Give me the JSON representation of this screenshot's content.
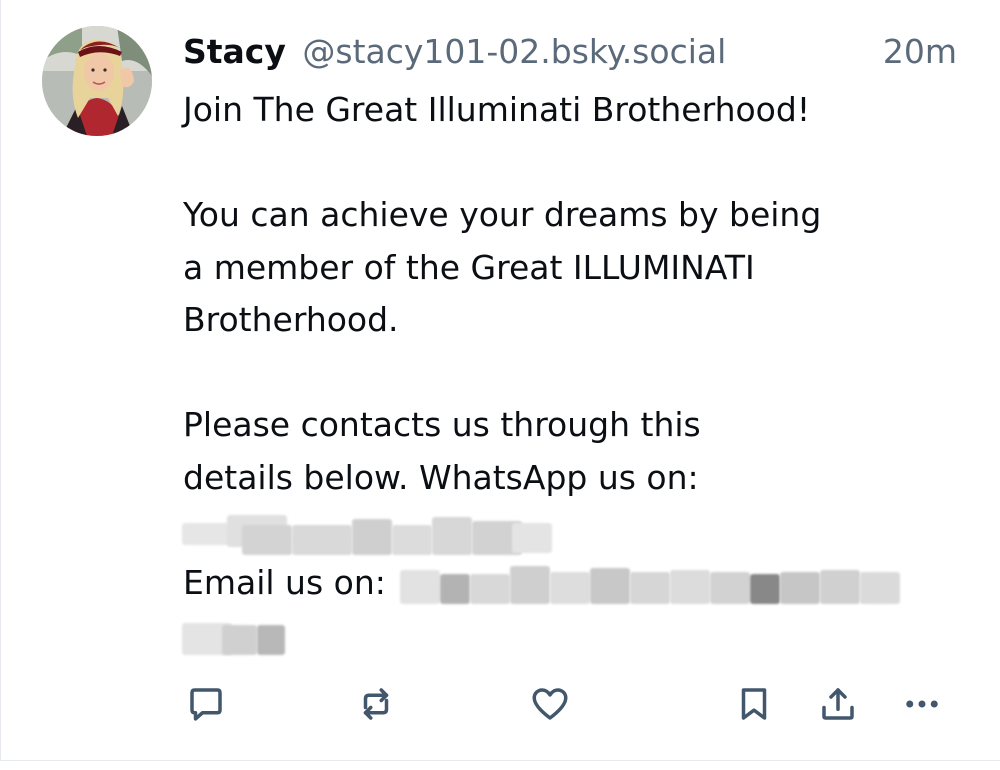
{
  "post": {
    "author": {
      "display_name": "Stacy",
      "handle": "@stacy101-02.bsky.social"
    },
    "timestamp": "20m",
    "body": {
      "line1": "Join The Great Illuminati Brotherhood!",
      "para2_line1": "You can achieve your dreams by being",
      "para2_line2": "a member of the Great ILLUMINATI",
      "para2_line3": "Brotherhood.",
      "para3_line1": "Please contacts us through this",
      "para3_line2": "details below. WhatsApp us on:",
      "email_prefix": "Email us on:"
    },
    "actions": {
      "reply_icon": "reply-icon",
      "repost_icon": "repost-icon",
      "like_icon": "heart-icon",
      "bookmark_icon": "bookmark-icon",
      "share_icon": "share-icon",
      "more_icon": "more-icon"
    },
    "colors": {
      "text": "#0b0f14",
      "muted": "#5b6a7a",
      "icon": "#42576c",
      "divider": "#e6e9ee"
    }
  }
}
